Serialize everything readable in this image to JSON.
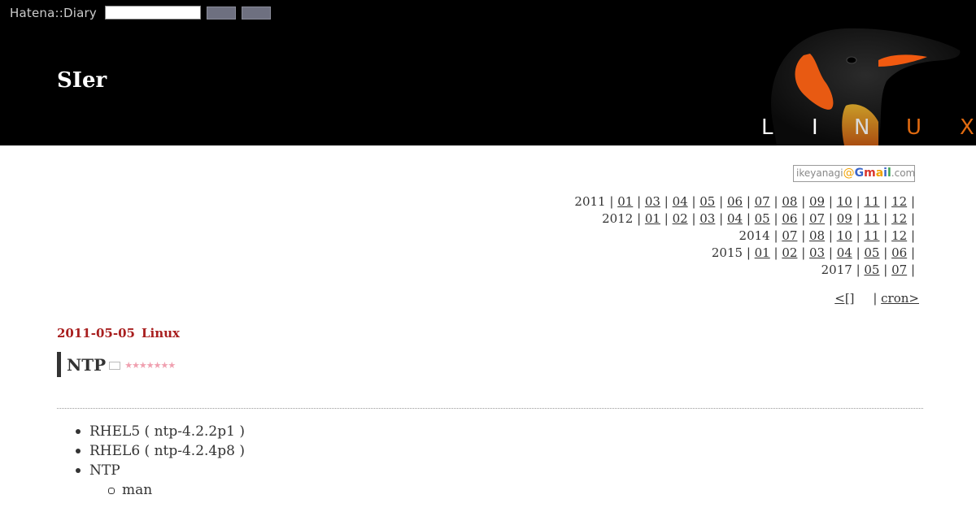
{
  "hatena": {
    "logo": "Hatena::Diary",
    "search_value": "",
    "button1": "",
    "button2": ""
  },
  "header": {
    "title": "SIer",
    "banner_letters": [
      "L",
      "I",
      "N",
      "U",
      "X"
    ]
  },
  "gmail": {
    "user": "ikeyanagi",
    "at": "@",
    "brand": [
      "G",
      "m",
      "a",
      "i",
      "l"
    ],
    "domain": ".com"
  },
  "archive": [
    {
      "year": "2011",
      "months": [
        "01",
        "03",
        "04",
        "05",
        "06",
        "07",
        "08",
        "09",
        "10",
        "11",
        "12"
      ]
    },
    {
      "year": "2012",
      "months": [
        "01",
        "02",
        "03",
        "04",
        "05",
        "06",
        "07",
        "09",
        "11",
        "12"
      ]
    },
    {
      "year": "2014",
      "months": [
        "07",
        "08",
        "10",
        "11",
        "12"
      ]
    },
    {
      "year": "2015",
      "months": [
        "01",
        "02",
        "03",
        "04",
        "05",
        "06"
      ]
    },
    {
      "year": "2017",
      "months": [
        "05",
        "07"
      ]
    }
  ],
  "pager": {
    "prev": "<[]",
    "separator": "|",
    "next": "cron>"
  },
  "entry": {
    "date": "2011-05-05",
    "category": "Linux",
    "title": "NTP",
    "stars": "★★★★★★★",
    "items": [
      "RHEL5 ( ntp-4.2.2p1 )",
      "RHEL6 ( ntp-4.2.4p8 )",
      "NTP"
    ],
    "subitems": [
      "man"
    ]
  },
  "colors": {
    "header_bg": "#000000",
    "date_red": "#a81e1e",
    "star_pink": "#f0a0b0"
  }
}
